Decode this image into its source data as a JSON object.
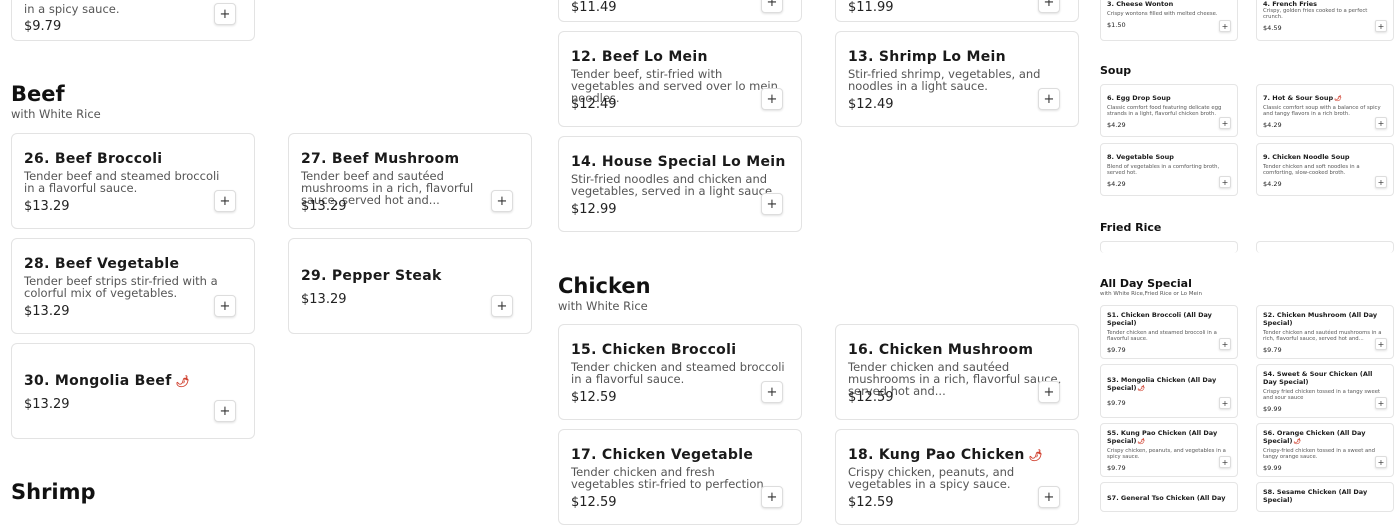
{
  "add_symbol": "+",
  "chili_symbol": "🌶",
  "sections": {
    "beef": {
      "title": "Beef",
      "subtitle": "with White Rice"
    },
    "chicken": {
      "title": "Chicken",
      "subtitle": "with White Rice"
    },
    "shrimp": {
      "title": "Shrimp"
    }
  },
  "items": {
    "top_left": {
      "desc": "in a spicy sauce.",
      "price": "$9.79"
    },
    "top_mid": {
      "price": "$11.49"
    },
    "top_right": {
      "price": "$11.99"
    },
    "beef_lo_mein": {
      "name": "12. Beef Lo Mein",
      "desc": "Tender beef, stir-fried with vegetables and served over lo mein noodles.",
      "price": "$12.49"
    },
    "shrimp_lo_mein": {
      "name": "13. Shrimp Lo Mein",
      "desc": "Stir-fried shrimp, vegetables, and noodles in a light sauce.",
      "price": "$12.49"
    },
    "house_lo_mein": {
      "name": "14. House Special Lo Mein",
      "desc": "Stir-fried noodles and chicken and vegetables, served in a light sauce.",
      "price": "$12.99"
    },
    "beef_broccoli": {
      "name": "26. Beef Broccoli",
      "desc": "Tender beef and steamed broccoli in a flavorful sauce.",
      "price": "$13.29"
    },
    "beef_mushroom": {
      "name": "27. Beef Mushroom",
      "desc": "Tender beef and sautéed mushrooms in a rich, flavorful sauce, served hot and...",
      "price": "$13.29"
    },
    "beef_vegetable": {
      "name": "28. Beef Vegetable",
      "desc": "Tender beef strips stir-fried with a colorful mix of vegetables.",
      "price": "$13.29"
    },
    "pepper_steak": {
      "name": "29. Pepper Steak",
      "price": "$13.29"
    },
    "mongolia_beef": {
      "name": "30. Mongolia Beef",
      "price": "$13.29"
    },
    "chicken_broccoli": {
      "name": "15. Chicken Broccoli",
      "desc": "Tender chicken and steamed broccoli in a flavorful sauce.",
      "price": "$12.59"
    },
    "chicken_mushroom": {
      "name": "16. Chicken Mushroom",
      "desc": "Tender chicken and sautéed mushrooms in a rich, flavorful sauce, served hot and...",
      "price": "$12.59"
    },
    "chicken_vegetable": {
      "name": "17. Chicken Vegetable",
      "desc": "Tender chicken and fresh vegetables stir-fried to perfection.",
      "price": "$12.59"
    },
    "kung_pao_chicken": {
      "name": "18. Kung Pao Chicken",
      "desc": "Crispy chicken, peanuts, and vegetables in a spicy sauce.",
      "price": "$12.59"
    }
  },
  "sidebar": {
    "cheese_wonton": {
      "name": "3. Cheese Wonton",
      "desc": "Crispy wontons filled with melted cheese.",
      "price": "$1.50"
    },
    "french_fries": {
      "name": "4. French Fries",
      "desc": "Crispy, golden fries cooked to a perfect crunch.",
      "price": "$4.59"
    },
    "soup_title": "Soup",
    "egg_drop": {
      "name": "6. Egg Drop Soup",
      "desc": "Classic comfort food featuring delicate egg strands in a light, flavorful chicken broth.",
      "price": "$4.29"
    },
    "hot_sour": {
      "name": "7. Hot & Sour Soup",
      "desc": "Classic comfort soup with a balance of spicy and tangy flavors in a rich broth.",
      "price": "$4.29"
    },
    "veg_soup": {
      "name": "8. Vegetable Soup",
      "desc": "Blend of vegetables in a comforting broth, served hot.",
      "price": "$4.29"
    },
    "chicken_noodle": {
      "name": "9. Chicken Noodle Soup",
      "desc": "Tender chicken and soft noodles in a comforting, slow-cooked broth.",
      "price": "$4.29"
    },
    "fried_rice_title": "Fried Rice",
    "ads_title": "All Day Special",
    "ads_subtitle": "with White Rice,Fried Rice or Lo Mein",
    "s1": {
      "name": "S1. Chicken Broccoli (All Day Special)",
      "desc": "Tender chicken and steamed broccoli in a flavorful sauce.",
      "price": "$9.79"
    },
    "s2": {
      "name": "S2. Chicken Mushroom (All Day Special)",
      "desc": "Tender chicken and sautéed mushrooms in a rich, flavorful sauce, served hot and...",
      "price": "$9.79"
    },
    "s3": {
      "name": "S3. Mongolia Chicken (All Day Special)",
      "price": "$9.79"
    },
    "s4": {
      "name": "S4. Sweet & Sour Chicken (All Day Special)",
      "desc": "Crispy fried chicken tossed in a tangy sweet and sour sauce",
      "price": "$9.99"
    },
    "s5": {
      "name": "S5. Kung Pao Chicken (All Day Special)",
      "desc": "Crispy chicken, peanuts, and vegetables in a spicy sauce.",
      "price": "$9.79"
    },
    "s6": {
      "name": "S6. Orange Chicken (All Day Special)",
      "desc": "Crispy-fried chicken tossed in a sweet and tangy orange sauce.",
      "price": "$9.99"
    },
    "s7": {
      "name": "S7. General Tso Chicken (All Day"
    },
    "s8": {
      "name": "S8. Sesame Chicken (All Day Special)"
    }
  }
}
